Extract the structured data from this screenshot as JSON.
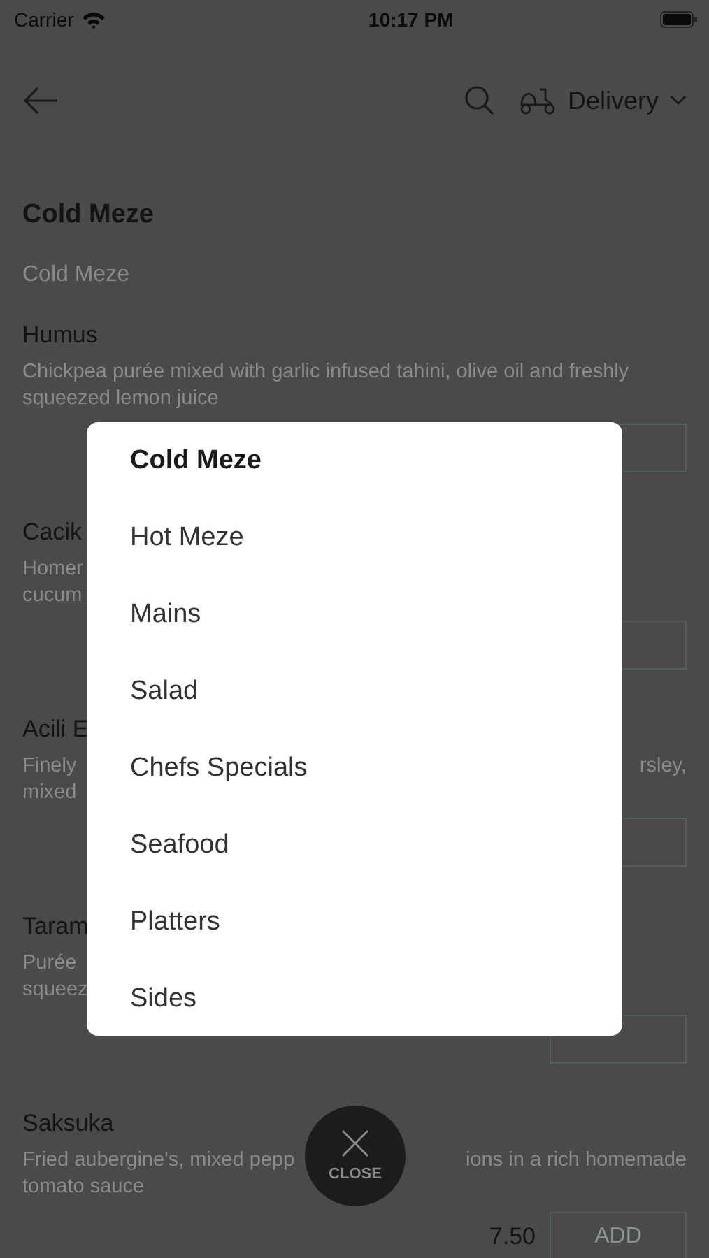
{
  "status_bar": {
    "carrier": "Carrier",
    "time": "10:17 PM"
  },
  "header": {
    "delivery_label": "Delivery"
  },
  "section_title": "Cold Meze",
  "section_subtitle": "Cold Meze",
  "items": [
    {
      "name": "Humus",
      "description": [
        {
          "left": "Chickpea purée mixed with garlic infused tahini, olive oil and freshly"
        },
        {
          "left": "squeezed lemon juice"
        }
      ]
    },
    {
      "name": "Cacik",
      "description": [
        {
          "left": "Homer"
        },
        {
          "left": "cucum"
        }
      ]
    },
    {
      "name": "Acili E",
      "description": [
        {
          "left": "Finely",
          "right": "rsley,"
        },
        {
          "left": "mixed"
        }
      ]
    },
    {
      "name": "Taram",
      "description": [
        {
          "left": "Purée"
        },
        {
          "left": "squeez"
        }
      ]
    },
    {
      "name": "Saksuka",
      "description": [
        {
          "left": "Fried aubergine's, mixed pepp",
          "right": "ions in a rich homemade"
        },
        {
          "left": "tomato sauce"
        }
      ],
      "price": "7.50",
      "add_label": "ADD"
    }
  ],
  "menu": {
    "items": [
      {
        "label": "Cold Meze",
        "selected": true
      },
      {
        "label": "Hot Meze",
        "selected": false
      },
      {
        "label": "Mains",
        "selected": false
      },
      {
        "label": "Salad",
        "selected": false
      },
      {
        "label": "Chefs Specials",
        "selected": false
      },
      {
        "label": "Seafood",
        "selected": false
      },
      {
        "label": "Platters",
        "selected": false
      },
      {
        "label": "Sides",
        "selected": false
      }
    ]
  },
  "close_button": {
    "label": "CLOSE"
  }
}
